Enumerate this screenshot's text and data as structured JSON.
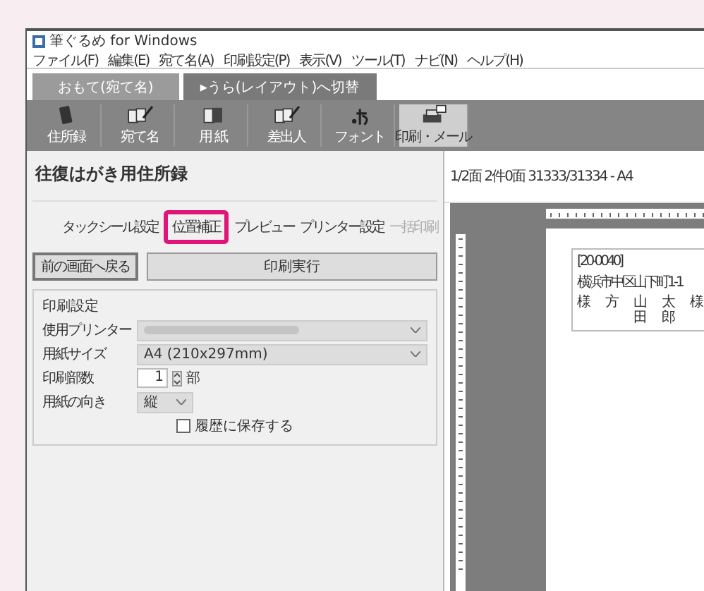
{
  "window": {
    "title": "筆ぐるめ for Windows"
  },
  "menu": [
    "ファイル(F)",
    "編集(E)",
    "宛て名(A)",
    "印刷設定(P)",
    "表示(V)",
    "ツール(T)",
    "ナビ(N)",
    "ヘルプ(H)"
  ],
  "tabs": [
    {
      "label": "おもて(宛て名)",
      "selected": true
    },
    {
      "label": "▸うら(レイアウト)へ切替",
      "selected": false
    }
  ],
  "toolbar": [
    {
      "label": "住所録",
      "kind": "book",
      "selected": false
    },
    {
      "label": "宛て名",
      "kind": "cards",
      "selected": false
    },
    {
      "label": "用 紙",
      "kind": "paper",
      "selected": false
    },
    {
      "label": "差出人",
      "kind": "cards",
      "selected": false
    },
    {
      "label": "フォント",
      "kind": "font",
      "selected": false
    },
    {
      "label": "印刷・メール",
      "kind": "printer",
      "selected": true
    }
  ],
  "panel": {
    "title": "往復はがき用住所録",
    "links": [
      {
        "label": "タックシール設定",
        "disabled": false,
        "highlighted": false
      },
      {
        "label": "位置補正",
        "disabled": false,
        "highlighted": true
      },
      {
        "label": "プレビュー",
        "disabled": false,
        "highlighted": false
      },
      {
        "label": "プリンター設定",
        "disabled": false,
        "highlighted": false
      },
      {
        "label": "一括印刷",
        "disabled": true,
        "highlighted": false
      }
    ],
    "buttons": [
      {
        "label": "前の画面へ戻る",
        "kind": "back"
      },
      {
        "label": "印刷実行",
        "kind": "print"
      }
    ],
    "group": {
      "title": "印刷設定",
      "rows": [
        {
          "label": "使用プリンター",
          "kind": "select",
          "blurred": true
        },
        {
          "label": "用紙サイズ",
          "kind": "select",
          "value": "A4 (210x297mm)",
          "blurred": false
        },
        {
          "label": "印刷部数",
          "kind": "spin",
          "value": "1",
          "unit": "部"
        },
        {
          "label": "用紙の向き",
          "kind": "small-select",
          "value": "縦"
        }
      ],
      "checkbox": {
        "label": "履歴に保存する",
        "checked": false
      }
    }
  },
  "preview": {
    "status": "1/2面 2件0面 31333/31334 - A4",
    "card": {
      "postal": "[20-0040]",
      "address": "横浜市中区山下町1-1",
      "names": [
        "様",
        "方",
        "山田",
        "太郎",
        "様"
      ]
    }
  }
}
